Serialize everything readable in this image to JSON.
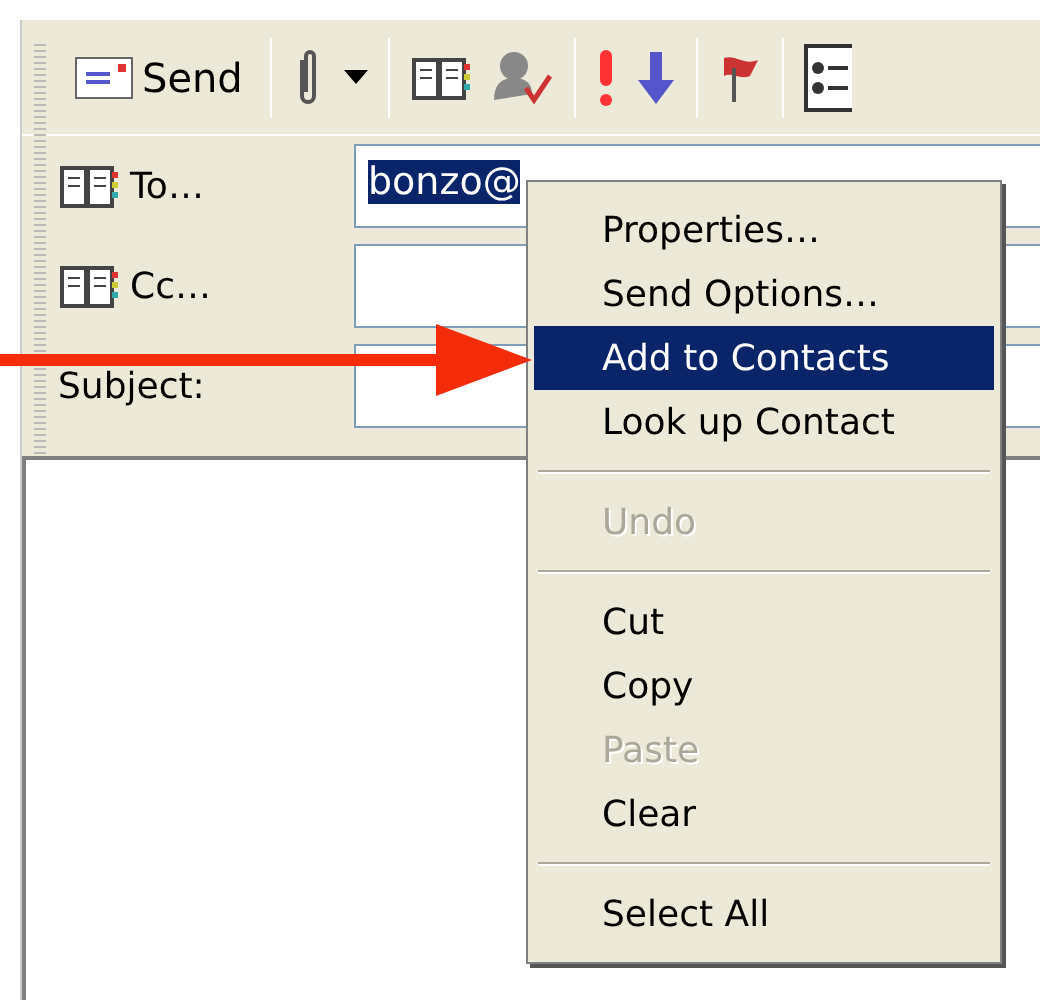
{
  "toolbar": {
    "send_label": "Send",
    "items": [
      {
        "kind": "send"
      },
      {
        "kind": "separator"
      },
      {
        "kind": "attach"
      },
      {
        "kind": "dropdown"
      },
      {
        "kind": "separator"
      },
      {
        "kind": "book"
      },
      {
        "kind": "check"
      },
      {
        "kind": "separator"
      },
      {
        "kind": "high"
      },
      {
        "kind": "low"
      },
      {
        "kind": "separator"
      },
      {
        "kind": "flag"
      },
      {
        "kind": "separator"
      },
      {
        "kind": "options"
      }
    ]
  },
  "fields": [
    {
      "kind": "book",
      "label": "To…",
      "value": "bonzo@",
      "selected": true
    },
    {
      "kind": "book",
      "label": "Cc…"
    },
    {
      "kind": "plain",
      "label": "Subject:"
    }
  ],
  "context_menu": {
    "items": [
      {
        "kind": "item",
        "label": "Properties…",
        "selected": false,
        "disabled": false
      },
      {
        "kind": "item",
        "label": "Send Options…",
        "selected": false,
        "disabled": false
      },
      {
        "kind": "item",
        "label": "Add to Contacts",
        "selected": true,
        "disabled": false
      },
      {
        "kind": "item",
        "label": "Look up Contact",
        "selected": false,
        "disabled": false
      },
      {
        "kind": "separator"
      },
      {
        "kind": "item",
        "label": "Undo",
        "selected": false,
        "disabled": true
      },
      {
        "kind": "separator"
      },
      {
        "kind": "item",
        "label": "Cut",
        "selected": false,
        "disabled": false
      },
      {
        "kind": "item",
        "label": "Copy",
        "selected": false,
        "disabled": false
      },
      {
        "kind": "item",
        "label": "Paste",
        "selected": false,
        "disabled": true
      },
      {
        "kind": "item",
        "label": "Clear",
        "selected": false,
        "disabled": false
      },
      {
        "kind": "separator"
      },
      {
        "kind": "item",
        "label": "Select All",
        "selected": false,
        "disabled": false
      }
    ]
  },
  "pointer_arrow": {
    "kind": "arrow"
  }
}
